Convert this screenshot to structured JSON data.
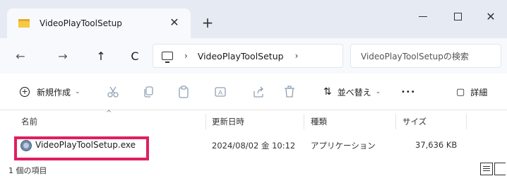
{
  "window": {
    "tab_title": "VideoPlayToolSetup",
    "tab_close": "✕",
    "new_tab": "+",
    "close": "✕"
  },
  "nav": {
    "back": "←",
    "forward": "→",
    "up": "↑",
    "refresh": "C",
    "path_separator": "›",
    "breadcrumb": "VideoPlayToolSetup",
    "search_placeholder": "VideoPlayToolSetupの検索"
  },
  "toolbar": {
    "new_label": "新規作成",
    "new_icon_glyph": "+",
    "chevron": "⌄",
    "sort_icon_glyph": "⇅",
    "sort_label": "並べ替え",
    "more": "•••",
    "details_icon_glyph": "▢",
    "details_label": "詳細"
  },
  "columns": {
    "name": "名前",
    "modified": "更新日時",
    "type": "種類",
    "size": "サイズ"
  },
  "files": [
    {
      "name": "VideoPlayToolSetup.exe",
      "modified": "2024/08/02 金 10:12",
      "type": "アプリケーション",
      "size": "37,636 KB"
    }
  ],
  "status": {
    "item_count": "1 個の項目"
  },
  "colors": {
    "highlight": "#e01f62",
    "titlebar": "#e6ebf3",
    "folder": "#f6c942"
  }
}
